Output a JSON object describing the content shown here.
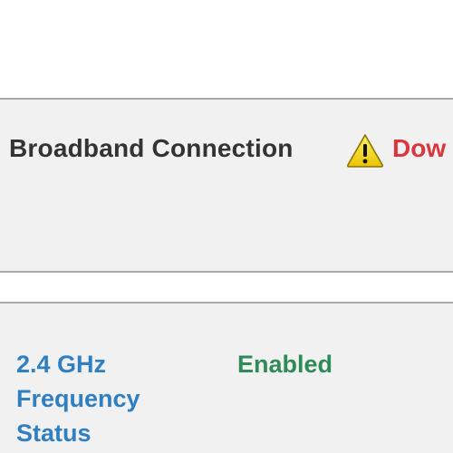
{
  "broadband": {
    "title": "Broadband Connection",
    "status_icon": "warning-icon",
    "status_text": "Dow",
    "status_color": "#d9363e"
  },
  "wifi_24": {
    "label": "2.4 GHz Frequency Status",
    "status_text": "Enabled",
    "status_color": "#2e8b57",
    "label_color": "#2f7fc1"
  },
  "colors": {
    "panel_background": "#f1f1f1",
    "border": "#a9a9a9",
    "title_text": "#333333",
    "warning_fill": "#f2d21b"
  }
}
